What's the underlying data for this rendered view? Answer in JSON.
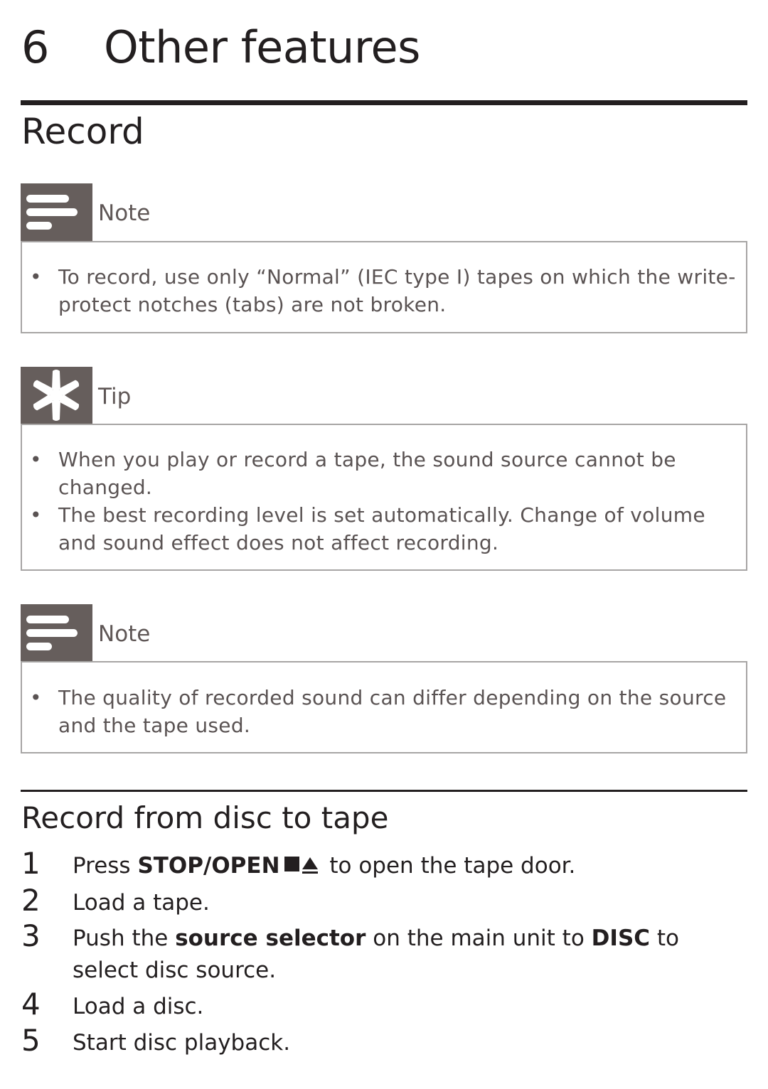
{
  "chapter": {
    "number": "6",
    "title": "Other features"
  },
  "section": {
    "title": "Record"
  },
  "callouts": [
    {
      "type": "note",
      "icon": "note-lines-icon",
      "label": "Note",
      "bullets": [
        "To record, use only “Normal” (IEC type I) tapes on which the write-protect notches (tabs) are not broken."
      ]
    },
    {
      "type": "tip",
      "icon": "asterisk-tip-icon",
      "label": "Tip",
      "bullets": [
        "When you play or record a tape, the sound source cannot be changed.",
        "The best recording level is set automatically. Change of volume and sound effect does not affect recording."
      ]
    },
    {
      "type": "note",
      "icon": "note-lines-icon",
      "label": "Note",
      "bullets": [
        "The quality of recorded sound can differ depending on the source and the tape used."
      ]
    }
  ],
  "bullet_char": "•",
  "subsection": {
    "title": "Record from disc to tape",
    "steps": [
      {
        "number": "1",
        "parts": {
          "a": "Press ",
          "b": "STOP/OPEN",
          "c": " to open the tape door."
        }
      },
      {
        "number": "2",
        "text": "Load a tape."
      },
      {
        "number": "3",
        "parts": {
          "a": "Push the ",
          "b": "source selector",
          "c": " on the main unit to ",
          "d": "DISC",
          "e": " to select disc source."
        }
      },
      {
        "number": "4",
        "text": "Load a disc."
      },
      {
        "number": "5",
        "text": "Start disc playback."
      }
    ]
  }
}
